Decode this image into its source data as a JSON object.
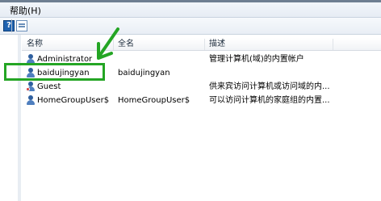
{
  "menubar": {
    "help_label": "帮助(H)"
  },
  "toolbar": {
    "help_button": "?",
    "view_button": "view"
  },
  "list": {
    "columns": [
      "名称",
      "全名",
      "描述"
    ],
    "rows": [
      {
        "name": "Administrator",
        "full_name": "",
        "description": "管理计算机(域)的内置帐户",
        "icon": "user-icon"
      },
      {
        "name": "baidujingyan",
        "full_name": "baidujingyan",
        "description": "",
        "icon": "user-icon"
      },
      {
        "name": "Guest",
        "full_name": "",
        "description": "供来宾访问计算机或访问域的内...",
        "icon": "user-disabled-icon"
      },
      {
        "name": "HomeGroupUser$",
        "full_name": "HomeGroupUser$",
        "description": "可以访问计算机的家庭组的内置...",
        "icon": "user-icon"
      }
    ]
  },
  "annotation": {
    "highlight_color": "#24a524",
    "arrow_color": "#24a524"
  }
}
